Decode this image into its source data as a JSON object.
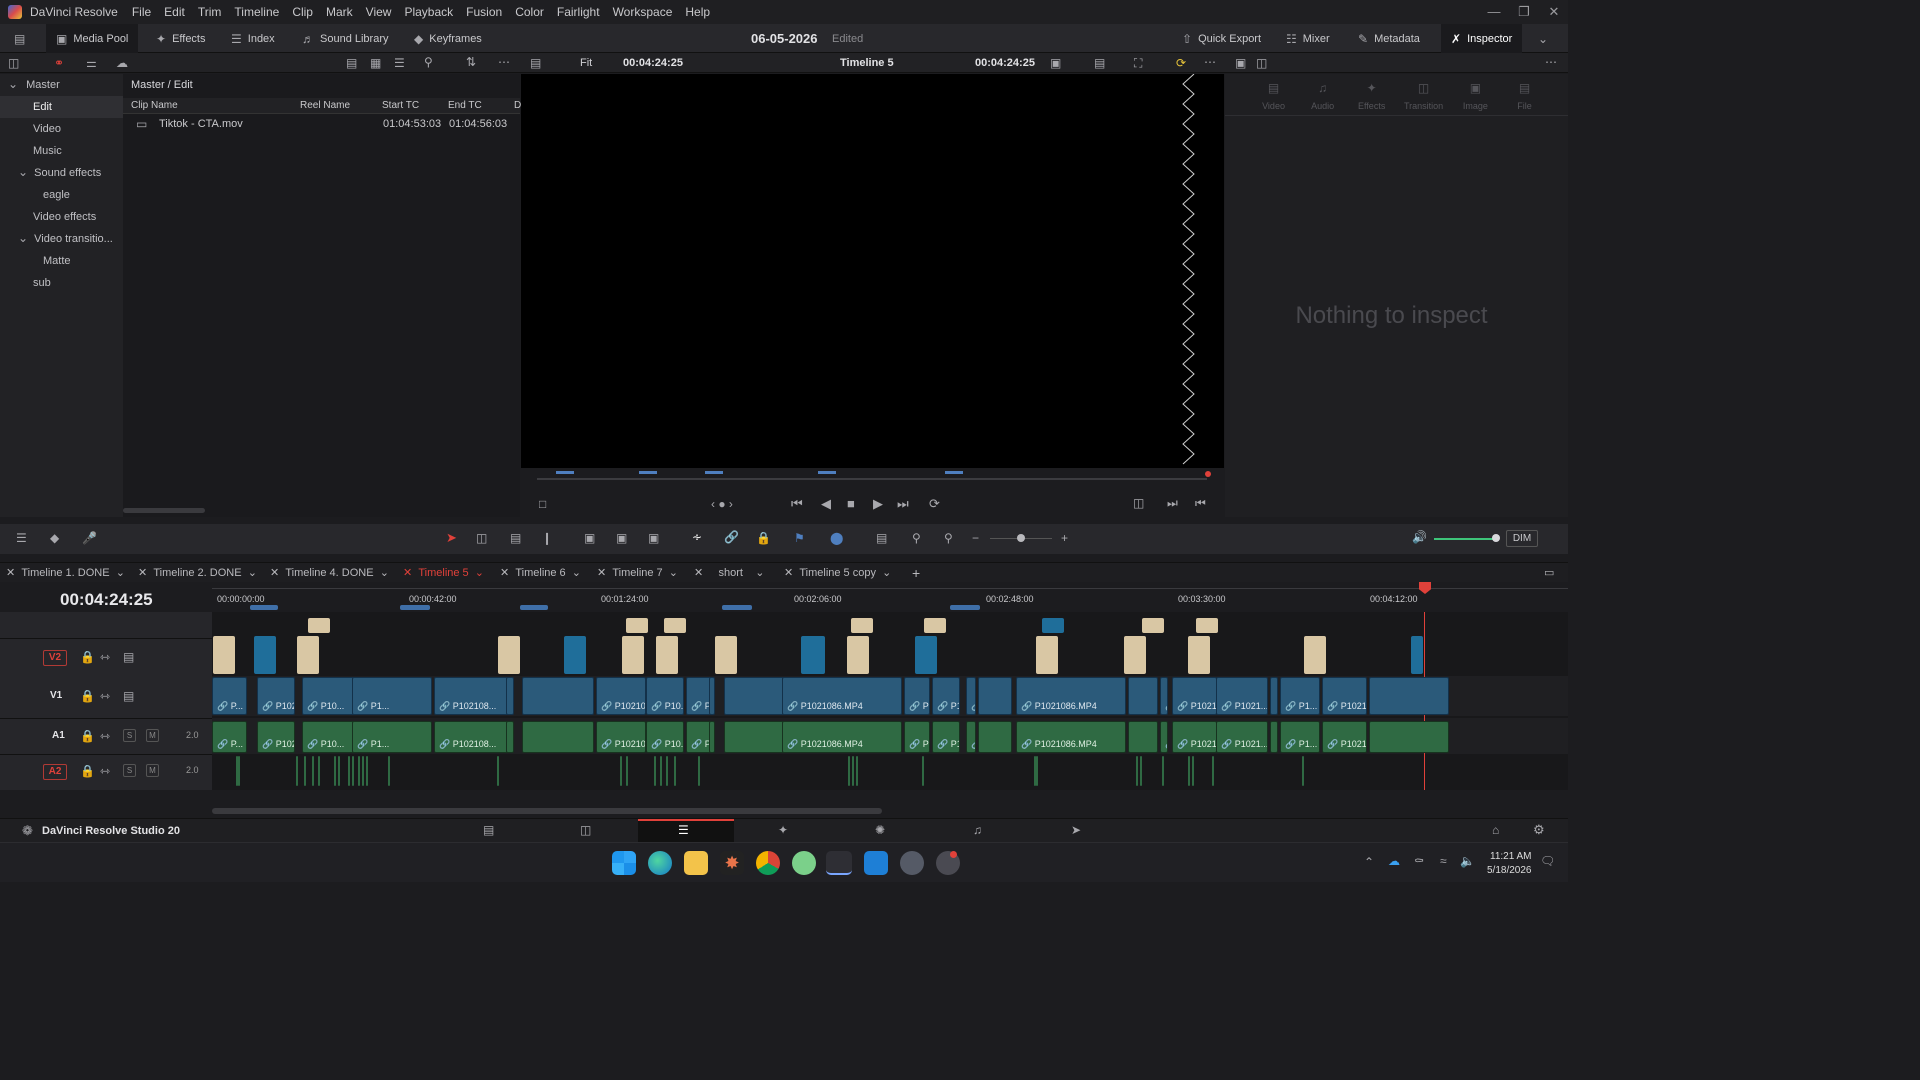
{
  "app": {
    "name": "DaVinci Resolve",
    "product": "DaVinci Resolve Studio 20"
  },
  "menu": [
    "File",
    "Edit",
    "Trim",
    "Timeline",
    "Clip",
    "Mark",
    "View",
    "Playback",
    "Fusion",
    "Color",
    "Fairlight",
    "Workspace",
    "Help"
  ],
  "toolbar": {
    "media_pool": "Media Pool",
    "effects": "Effects",
    "index": "Index",
    "sound_library": "Sound Library",
    "keyframes": "Keyframes",
    "project_title": "06-05-2026",
    "project_status": "Edited",
    "quick_export": "Quick Export",
    "mixer": "Mixer",
    "metadata": "Metadata",
    "inspector": "Inspector"
  },
  "viewer": {
    "zoom": "Fit",
    "left_tc": "00:04:24:25",
    "timeline_name": "Timeline 5",
    "right_tc": "00:04:24:25"
  },
  "bins": {
    "root": "Master",
    "items": [
      {
        "label": "Edit",
        "selected": true
      },
      {
        "label": "Video"
      },
      {
        "label": "Music"
      },
      {
        "label": "Sound effects"
      },
      {
        "label": "eagle"
      },
      {
        "label": "Video effects"
      },
      {
        "label": "Video transitio..."
      },
      {
        "label": "Matte"
      },
      {
        "label": "sub"
      }
    ]
  },
  "pool": {
    "path": "Master / Edit",
    "columns": [
      "Clip Name",
      "Reel Name",
      "Start TC",
      "End TC",
      "D"
    ],
    "rows": [
      {
        "name": "Tiktok - CTA.mov",
        "reel": "",
        "start": "01:04:53:03",
        "end": "01:04:56:03"
      }
    ]
  },
  "inspector": {
    "tabs": [
      "Video",
      "Audio",
      "Effects",
      "Transition",
      "Image",
      "File"
    ],
    "empty": "Nothing to inspect"
  },
  "audio": {
    "dim": "DIM"
  },
  "timeline": {
    "timecode": "00:04:24:25",
    "tabs": [
      "Timeline 1. DONE",
      "Timeline 2. DONE",
      "Timeline 4. DONE",
      "Timeline 5",
      "Timeline 6",
      "Timeline 7",
      "short",
      "Timeline 5 copy"
    ],
    "active_tab": "Timeline 5",
    "ruler": [
      "00:00:00:00",
      "00:00:42:00",
      "00:01:24:00",
      "00:02:06:00",
      "00:02:48:00",
      "00:03:30:00",
      "00:04:12:00"
    ],
    "tracks": {
      "v2": "V2",
      "v1": "V1",
      "a1": "A1",
      "a2": "A2",
      "a1_ch": "2.0",
      "a2_ch": "2.0",
      "solo": "S",
      "mute": "M"
    },
    "v1_clips": [
      "P...",
      "P1021086.MP4",
      "P10...",
      "P1...",
      "P102108...",
      "P102108...",
      "P10...",
      "P102...",
      "P102...",
      "P1021086.MP4",
      "P1...",
      "P10...",
      "P10...",
      "P1021086.MP4",
      "P1...",
      "P1021086.M...",
      "P1021...",
      "P1...",
      "P1021..."
    ],
    "a1_clips": [
      "P...",
      "P1021086.MP4",
      "P10...",
      "P1...",
      "P102108...",
      "P102108...",
      "P10...",
      "P102...",
      "P102...",
      "P1021086.MP4",
      "P1...",
      "P10...",
      "P10...",
      "P1021086.MP4",
      "P1...",
      "P1021086.M...",
      "P1021...",
      "P1...",
      "P1021..."
    ]
  },
  "taskbar": {
    "time": "11:21 AM",
    "date": "5/18/2026"
  },
  "colors": {
    "accent_red": "#e0413a",
    "video_clip": "#2b5a7a",
    "audio_clip": "#2f6a43",
    "title_clip": "#d9c7a4",
    "compound_clip": "#1f6e9a"
  }
}
